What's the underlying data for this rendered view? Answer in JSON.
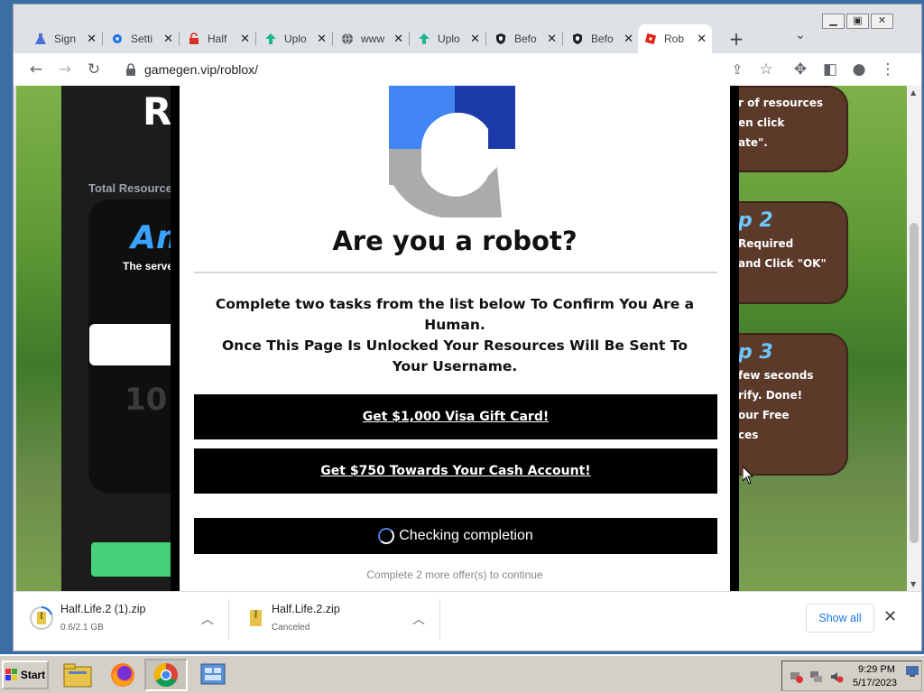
{
  "browser": {
    "tabs": [
      {
        "label": "Sign",
        "icon": "flask-icon"
      },
      {
        "label": "Setti",
        "icon": "gear-icon"
      },
      {
        "label": "Half",
        "icon": "lock-icon"
      },
      {
        "label": "Uplo",
        "icon": "upload-icon"
      },
      {
        "label": "www",
        "icon": "globe-icon"
      },
      {
        "label": "Uplo",
        "icon": "upload-icon"
      },
      {
        "label": "Befo",
        "icon": "shield-icon"
      },
      {
        "label": "Befo",
        "icon": "shield-icon"
      },
      {
        "label": "Rob",
        "icon": "roblox-icon"
      }
    ],
    "active_tab_index": 8,
    "url": "gamegen.vip/roblox/"
  },
  "background_page": {
    "heading_fragment": "R",
    "total_resources_fragment": "Total Resource",
    "amount_fragment": "Am",
    "server_fragment": "The serve",
    "number_fragment": "10",
    "step1_lines": [
      "r of resources",
      "en click",
      "ate\"."
    ],
    "step2_title": "p 2",
    "step2_lines": [
      "Required",
      "and Click \"OK\""
    ],
    "step3_title": "p 3",
    "step3_lines": [
      "few seconds",
      "rify. Done!",
      "our Free",
      "ces"
    ]
  },
  "modal": {
    "title": "Are you a robot?",
    "instruction": "Complete two tasks from the list below To Confirm You Are a Human.",
    "unlock_note": "Once This Page Is Unlocked Your Resources Will Be Sent To Your Username.",
    "offers": [
      "Get $1,000 Visa Gift Card!",
      "Get $750 Towards Your Cash Account!"
    ],
    "checking_label": "Checking completion",
    "footer": "Complete 2 more offer(s) to continue"
  },
  "downloads": [
    {
      "name": "Half.Life.2 (1).zip",
      "status": "0.6/2.1 GB"
    },
    {
      "name": "Half.Life.2.zip",
      "status": "Canceled"
    }
  ],
  "download_bar": {
    "show_all": "Show all"
  },
  "taskbar": {
    "start_label": "Start",
    "time": "9:29 PM",
    "date": "5/17/2023"
  },
  "colors": {
    "offer_bg": "#000000",
    "link_blue": "#1a73e8",
    "captcha_blue": "#1c3aa9",
    "captcha_light_blue": "#4285f4",
    "captcha_gray": "#ababab"
  }
}
